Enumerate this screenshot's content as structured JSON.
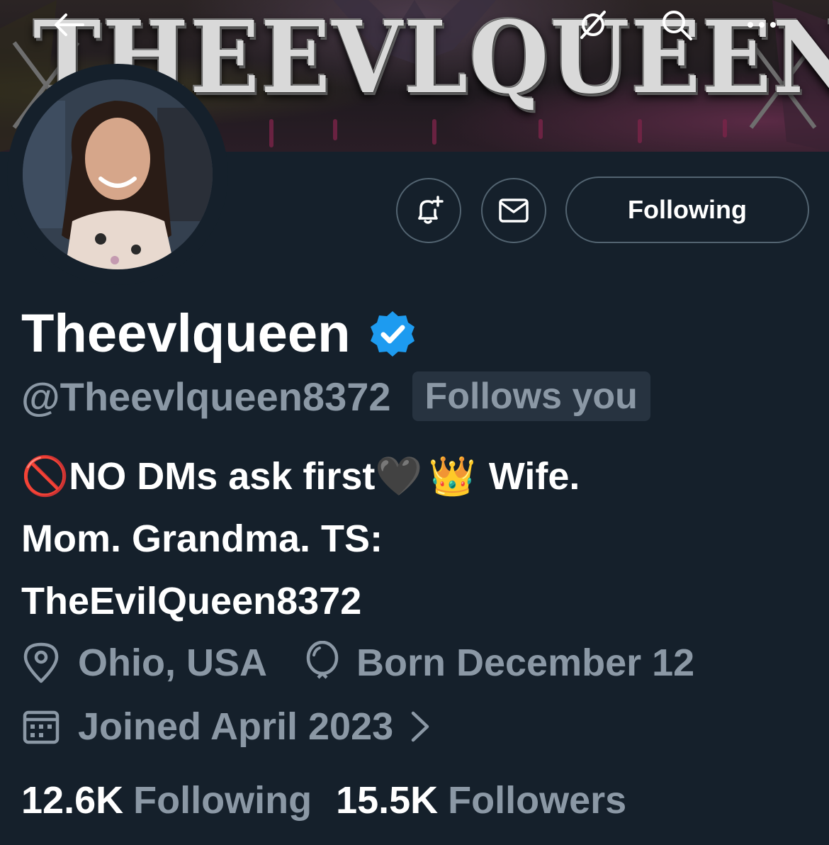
{
  "header": {
    "banner_text": "THEEVLQUEEN",
    "icons": [
      "back-arrow-icon",
      "grok-icon",
      "search-icon",
      "more-icon"
    ]
  },
  "actions": {
    "notify_icon": "bell-plus-icon",
    "message_icon": "envelope-icon",
    "follow_label": "Following"
  },
  "profile": {
    "display_name": "Theevlqueen",
    "verified": true,
    "handle": "@Theevlqueen8372",
    "follows_you": "Follows you",
    "bio": {
      "line1_prefix_emoji": "🚫",
      "line1_text": "NO DMs ask first",
      "line1_heart": "🖤",
      "line1_crown": "👑",
      "line1_suffix": "Wife.",
      "line2": "Mom. Grandma. TS:",
      "line3": "TheEvilQueen8372"
    },
    "location": "Ohio, USA",
    "birthday": "Born December 12",
    "joined": "Joined April 2023"
  },
  "stats": {
    "following_count": "12.6K",
    "following_label": "Following",
    "followers_count": "15.5K",
    "followers_label": "Followers"
  },
  "colors": {
    "background": "#15202b",
    "secondary_text": "#8b98a5",
    "border": "#536471",
    "verified": "#1d9bf0"
  }
}
